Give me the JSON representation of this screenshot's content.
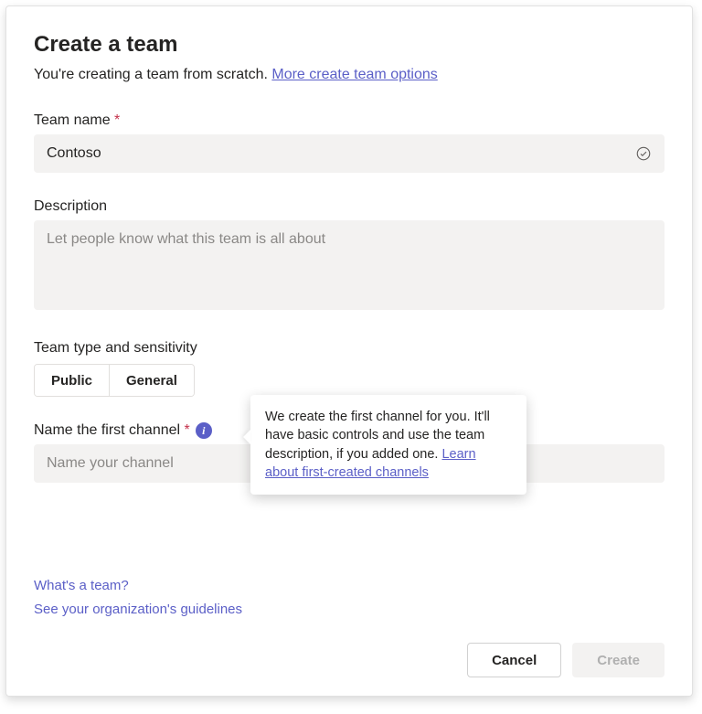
{
  "dialog": {
    "title": "Create a team",
    "subtitle_prefix": "You're creating a team from scratch. ",
    "more_options_link": "More create team options"
  },
  "team_name": {
    "label": "Team name",
    "required_mark": "*",
    "value": "Contoso"
  },
  "description": {
    "label": "Description",
    "placeholder": "Let people know what this team is all about",
    "value": ""
  },
  "sensitivity": {
    "label": "Team type and sensitivity",
    "option_public": "Public",
    "option_general": "General"
  },
  "channel": {
    "label": "Name the first channel",
    "required_mark": "*",
    "placeholder": "Name your channel",
    "info_glyph": "i",
    "tooltip_text": "We create the first channel for you. It'll have basic controls and use the team description, if you added one. ",
    "tooltip_link": "Learn about first-created channels"
  },
  "footer": {
    "whats_a_team": "What's a team?",
    "guidelines": "See your organization's guidelines",
    "cancel": "Cancel",
    "create": "Create"
  }
}
